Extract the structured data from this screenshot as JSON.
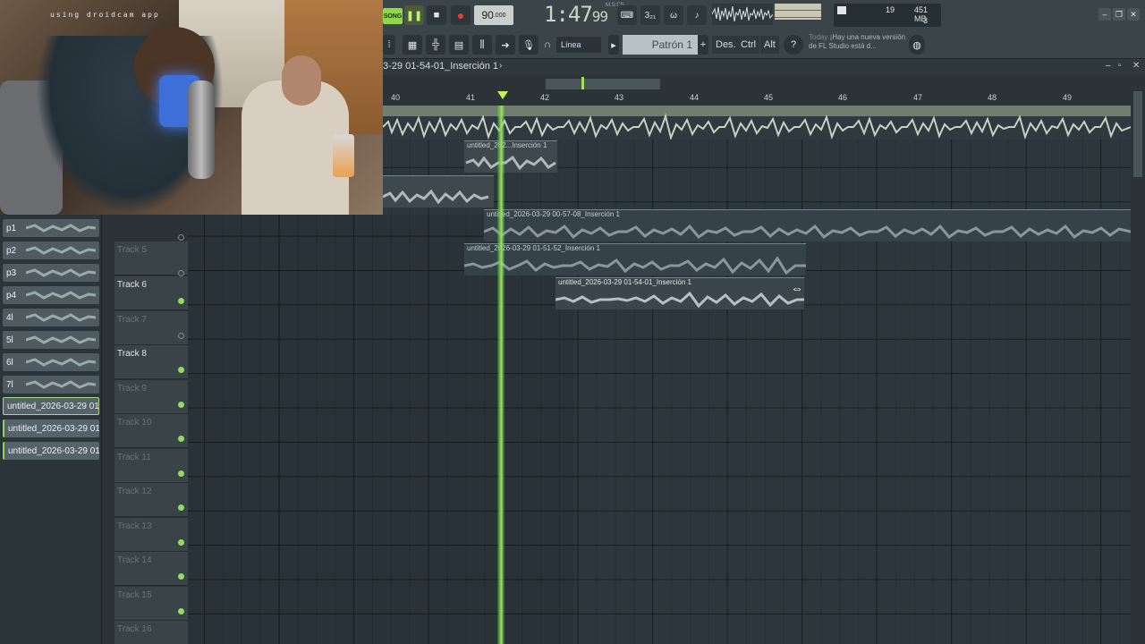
{
  "webcam": {
    "label": "using droidcam app"
  },
  "transport": {
    "mode": "SONG",
    "pause_icon": "pause-icon",
    "stop_icon": "stop-icon",
    "record_icon": "record-icon",
    "tempo": "90",
    "tempo_decimal": ".000",
    "time": "1:47",
    "time_frac": "99",
    "time_unit": "M:S:CS"
  },
  "monitor": {
    "cpu": "19",
    "memory": "451 MB",
    "polyphony": "3"
  },
  "toolbar2": {
    "snap": "Línea",
    "pattern": "Patrón 1",
    "plus": "+",
    "keys": [
      "Des.",
      "Ctrl",
      "Alt"
    ],
    "hint_today": "Today",
    "hint_text": "¡Hay una nueva versión de FL Studio está d..."
  },
  "playlist": {
    "breadcrumb": "3-29 01-54-01_Inserción 1",
    "bars": [
      "40",
      "41",
      "42",
      "43",
      "44",
      "45",
      "46",
      "47",
      "48",
      "49"
    ]
  },
  "picker": {
    "items": [
      "p1",
      "p2",
      "p3",
      "p4",
      "4l",
      "5l",
      "6l",
      "7l"
    ],
    "audio": [
      "untitled_2026-03-29 01-...",
      "untitled_2026-03-29 01-...",
      "untitled_2026-03-29 01-..."
    ]
  },
  "tracks": [
    {
      "name": "Track 5",
      "active": false
    },
    {
      "name": "Track 6",
      "active": true
    },
    {
      "name": "Track 7",
      "active": false
    },
    {
      "name": "Track 8",
      "active": true
    },
    {
      "name": "Track 9",
      "active": true
    },
    {
      "name": "Track 10",
      "active": true
    },
    {
      "name": "Track 11",
      "active": true
    },
    {
      "name": "Track 12",
      "active": true
    },
    {
      "name": "Track 13",
      "active": true
    },
    {
      "name": "Track 14",
      "active": true
    },
    {
      "name": "Track 15",
      "active": true
    },
    {
      "name": "Track 16",
      "active": true
    }
  ],
  "clips": {
    "c1": "untitled_202...Inserción 1",
    "c2": "untitled_2026-03-29 00-57-08_Inserción 1",
    "c3": "untitled_2026-03-29 01-51-52_Inserción 1",
    "c4": "untitled_2026-03-29 01-54-01_Inserción 1"
  },
  "colors": {
    "playhead": "#7ad247",
    "accent": "#8ed84a",
    "record": "#e33d3d"
  }
}
